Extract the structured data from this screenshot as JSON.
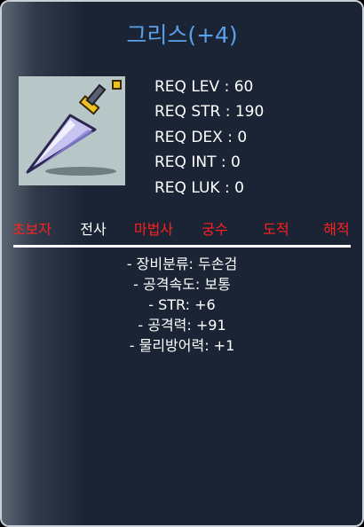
{
  "item": {
    "name": "그리스(+4)",
    "icon": "greatsword-icon"
  },
  "requirements": [
    "REQ LEV : 60",
    "REQ STR : 190",
    "REQ DEX : 0",
    "REQ INT : 0",
    "REQ LUK : 0"
  ],
  "jobs": [
    {
      "label": "초보자",
      "color": "#ff1f1f"
    },
    {
      "label": "전사",
      "color": "#ffffff"
    },
    {
      "label": "마법사",
      "color": "#ff1f1f"
    },
    {
      "label": "궁수",
      "color": "#ff1f1f"
    },
    {
      "label": "도적",
      "color": "#ff1f1f"
    },
    {
      "label": "해적",
      "color": "#ff1f1f"
    }
  ],
  "stats": [
    "- 장비분류: 두손검",
    "- 공격속도: 보통",
    "- STR: +6",
    "- 공격력: +91",
    "- 물리방어력: +1"
  ],
  "colors": {
    "title": "#5aa0ea",
    "panel": "#1b2434",
    "unavailable_job": "#ff1f1f",
    "available_job": "#ffffff"
  }
}
